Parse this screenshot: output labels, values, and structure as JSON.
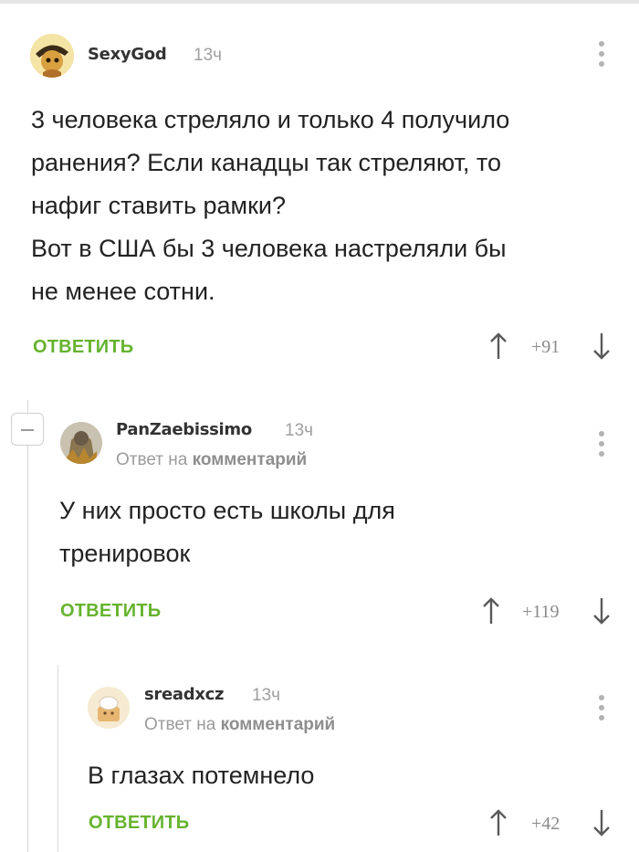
{
  "comments": [
    {
      "username": "SexyGod",
      "time": "13ч",
      "text": [
        "3 человека стреляло и только 4 получило",
        "ранения? Если канадцы так стреляют, то",
        "нафиг ставить рамки?",
        "Вот в США бы 3 человека настреляли бы",
        "не менее сотни."
      ],
      "reply_label": "ОТВЕТИТЬ",
      "rating": "+91"
    },
    {
      "username": "PanZaebissimo",
      "time": "13ч",
      "reply_prefix": "Ответ на",
      "reply_target": "комментарий",
      "text": [
        "У них просто есть школы для",
        "тренировок"
      ],
      "reply_label": "ОТВЕТИТЬ",
      "rating": "+119"
    },
    {
      "username": "sreadxcz",
      "time": "13ч",
      "reply_prefix": "Ответ на",
      "reply_target": "комментарий",
      "text": [
        "В глазах потемнело"
      ],
      "reply_label": "ОТВЕТИТЬ",
      "rating": "+42"
    }
  ],
  "icons": [
    "avatar",
    "more-icon",
    "arrow-up-icon",
    "arrow-down-icon",
    "collapse-icon"
  ],
  "colors": {
    "accent": "#66b32e",
    "muted": "#a0a0a0",
    "text": "#222222"
  }
}
